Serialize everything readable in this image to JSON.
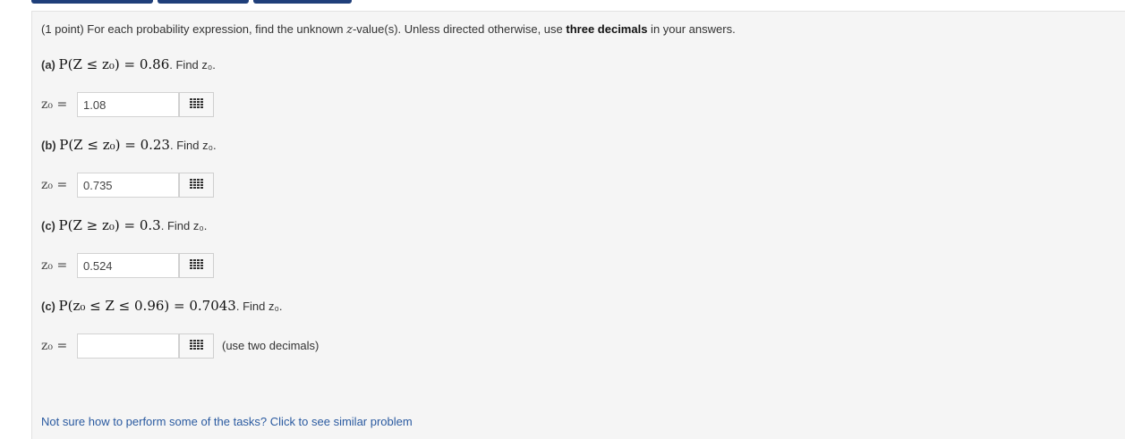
{
  "intro": {
    "prefix": "(1 point) For each probability expression, find the unknown ",
    "zvar": "z",
    "middle": "-value(s). Unless directed otherwise, use ",
    "bold": "three decimals",
    "suffix": " in your answers."
  },
  "parts": [
    {
      "label": "(a)",
      "expr": "P(Z ≤ z₀) = 0.86",
      "find": ". Find z₀."
    },
    {
      "label": "(b)",
      "expr": "P(Z ≤ z₀) = 0.23",
      "find": ". Find z₀."
    },
    {
      "label": "(c)",
      "expr": "P(Z ≥ z₀) = 0.3",
      "find": ". Find z₀."
    },
    {
      "label": "(c)",
      "expr": "P(z₀ ≤ Z ≤ 0.96) = 0.7043",
      "find": ". Find z₀."
    }
  ],
  "answers": [
    {
      "label": "z₀ =",
      "value": "1.08",
      "hint": ""
    },
    {
      "label": "z₀ =",
      "value": "0.735",
      "hint": ""
    },
    {
      "label": "z₀ =",
      "value": "0.524",
      "hint": ""
    },
    {
      "label": "z₀ =",
      "value": "",
      "hint": "(use two decimals)"
    }
  ],
  "link_text": "Not sure how to perform some of the tasks? Click to see similar problem",
  "colors": {
    "topbar": "#1f3f7a",
    "panel": "#f5f5f5",
    "link": "#2a5aa0"
  }
}
